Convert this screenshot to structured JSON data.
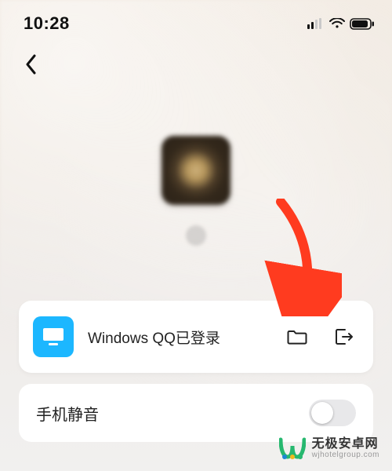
{
  "status": {
    "time": "10:28"
  },
  "card": {
    "label": "Windows QQ已登录"
  },
  "mute": {
    "label": "手机静音",
    "on": false
  },
  "watermark": {
    "title": "无极安卓网",
    "subtitle": "wjhotelgroup.com"
  },
  "colors": {
    "accent_blue": "#1cb7ff",
    "arrow_red": "#ff3b1f"
  }
}
